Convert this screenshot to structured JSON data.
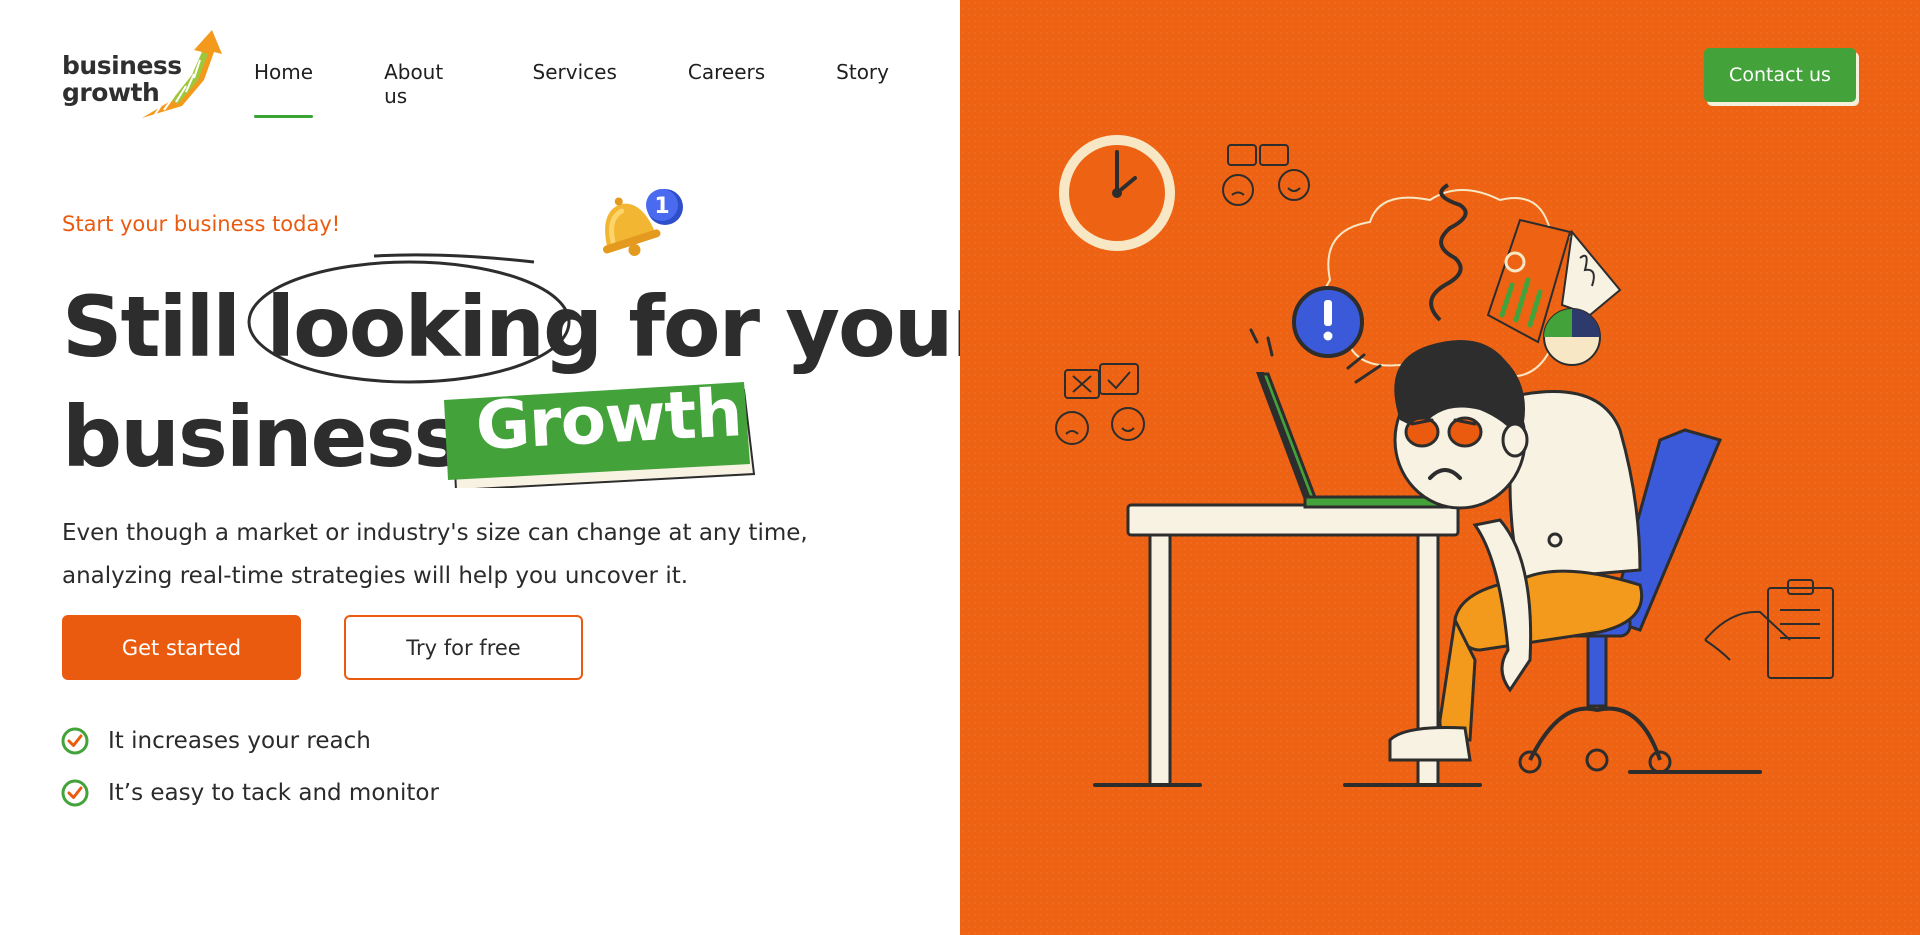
{
  "brand": {
    "logo_line1": "business",
    "logo_line2": "growth"
  },
  "nav": {
    "items": [
      {
        "label": "Home",
        "active": true
      },
      {
        "label": "About us",
        "active": false
      },
      {
        "label": "Services",
        "active": false
      },
      {
        "label": "Careers",
        "active": false
      },
      {
        "label": "Story",
        "active": false
      }
    ],
    "contact_label": "Contact us"
  },
  "hero": {
    "eyebrow": "Start your business today!",
    "notification_count": "1",
    "headline_still": "Still",
    "headline_looking": "looking",
    "headline_for_your": "for your",
    "headline_business": "business",
    "headline_growth": "Growth",
    "description_line1": "Even though a market or industry's size can change at any time,",
    "description_line2": "analyzing real-time strategies will help you uncover it.",
    "primary_cta": "Get started",
    "secondary_cta": "Try for free",
    "features": [
      "It increases your reach",
      "It’s easy to tack and monitor"
    ]
  },
  "colors": {
    "accent_orange": "#ea5b10",
    "accent_green": "#43a33a",
    "panel_orange": "#ee6313",
    "text_dark": "#2d2d2d"
  },
  "icons": [
    "logo-arrow-icon",
    "bell-icon",
    "check-circle-icon",
    "clock-icon",
    "exclamation-icon",
    "clipboard-icon"
  ]
}
